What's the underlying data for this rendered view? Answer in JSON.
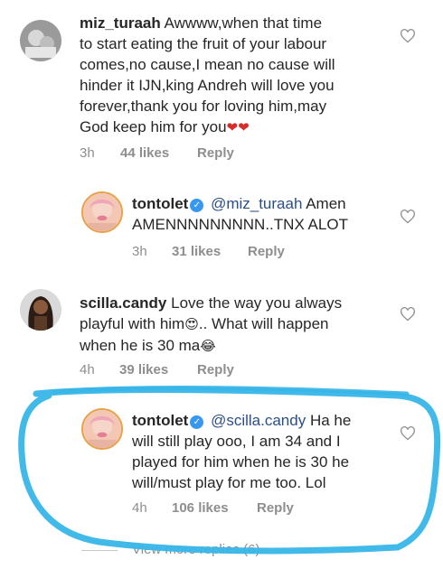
{
  "colors": {
    "username": "#262626",
    "mention": "#2a4f86",
    "meta": "#8e8e8e",
    "verified_badge": "#3897f0",
    "highlight_scribble": "#38b6e8"
  },
  "comments": [
    {
      "username": "miz_turaah",
      "text_parts": [
        "Awwww,when that time",
        "to start eating the fruit of your labour",
        "comes,no cause,I mean no cause will",
        "hinder it IJN,king Andreh will love you",
        "forever,thank you for loving him,may",
        "God keep him for you"
      ],
      "emoji": "❤❤",
      "time": "3h",
      "likes": "44 likes",
      "reply": "Reply",
      "avatar_icon": "user-avatar"
    },
    {
      "username": "tontolet",
      "verified": true,
      "mention": "@miz_turaah",
      "text_parts": [
        "Amen",
        "AMENNNNNNNNN..TNX ALOT"
      ],
      "time": "3h",
      "likes": "31 likes",
      "reply": "Reply",
      "avatar_icon": "user-avatar"
    },
    {
      "username": "scilla.candy",
      "text_parts": [
        "Love the way you always",
        "playful with him",
        ".. What will happen",
        "when he is 30 ma"
      ],
      "emoji_1": "😍",
      "emoji_2": "😂",
      "time": "4h",
      "likes": "39 likes",
      "reply": "Reply",
      "avatar_icon": "user-avatar"
    },
    {
      "username": "tontolet",
      "verified": true,
      "mention": "@scilla.candy",
      "text_parts": [
        "Ha he",
        "will still play ooo, I am 34 and I",
        "played for him when he is 30 he",
        "will/must play for me too. Lol"
      ],
      "time": "4h",
      "likes": "106 likes",
      "reply": "Reply",
      "avatar_icon": "user-avatar"
    }
  ],
  "view_more": "View more replies (6)",
  "icons": {
    "like": "heart-outline-icon",
    "verified": "verified-badge-icon"
  }
}
